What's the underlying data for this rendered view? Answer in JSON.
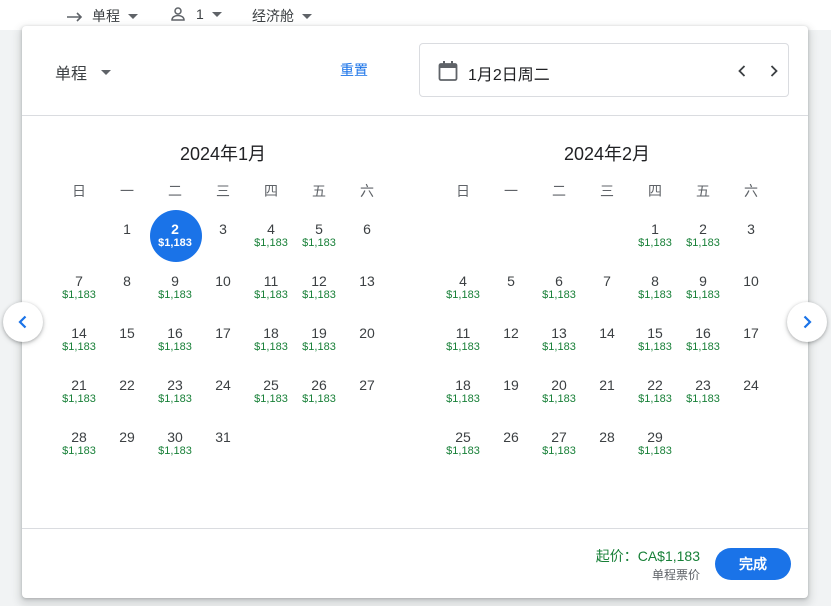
{
  "topbar": {
    "trip_type": "单程",
    "passengers": "1",
    "cabin": "经济舱"
  },
  "dialog": {
    "trip_select": "单程",
    "reset": "重置",
    "selected_date": "1月2日周二",
    "weekdays": [
      "日",
      "一",
      "二",
      "三",
      "四",
      "五",
      "六"
    ],
    "months": [
      {
        "title": "2024年1月",
        "first_weekday": 1,
        "days": [
          {
            "n": "1",
            "p": ""
          },
          {
            "n": "2",
            "p": "$1,183",
            "selected": true
          },
          {
            "n": "3",
            "p": ""
          },
          {
            "n": "4",
            "p": "$1,183"
          },
          {
            "n": "5",
            "p": "$1,183"
          },
          {
            "n": "6",
            "p": ""
          },
          {
            "n": "7",
            "p": "$1,183"
          },
          {
            "n": "8",
            "p": ""
          },
          {
            "n": "9",
            "p": "$1,183"
          },
          {
            "n": "10",
            "p": ""
          },
          {
            "n": "11",
            "p": "$1,183"
          },
          {
            "n": "12",
            "p": "$1,183"
          },
          {
            "n": "13",
            "p": ""
          },
          {
            "n": "14",
            "p": "$1,183"
          },
          {
            "n": "15",
            "p": ""
          },
          {
            "n": "16",
            "p": "$1,183"
          },
          {
            "n": "17",
            "p": ""
          },
          {
            "n": "18",
            "p": "$1,183"
          },
          {
            "n": "19",
            "p": "$1,183"
          },
          {
            "n": "20",
            "p": ""
          },
          {
            "n": "21",
            "p": "$1,183"
          },
          {
            "n": "22",
            "p": ""
          },
          {
            "n": "23",
            "p": "$1,183"
          },
          {
            "n": "24",
            "p": ""
          },
          {
            "n": "25",
            "p": "$1,183"
          },
          {
            "n": "26",
            "p": "$1,183"
          },
          {
            "n": "27",
            "p": ""
          },
          {
            "n": "28",
            "p": "$1,183"
          },
          {
            "n": "29",
            "p": ""
          },
          {
            "n": "30",
            "p": "$1,183"
          },
          {
            "n": "31",
            "p": ""
          }
        ]
      },
      {
        "title": "2024年2月",
        "first_weekday": 4,
        "days": [
          {
            "n": "1",
            "p": "$1,183"
          },
          {
            "n": "2",
            "p": "$1,183"
          },
          {
            "n": "3",
            "p": ""
          },
          {
            "n": "4",
            "p": "$1,183"
          },
          {
            "n": "5",
            "p": ""
          },
          {
            "n": "6",
            "p": "$1,183"
          },
          {
            "n": "7",
            "p": ""
          },
          {
            "n": "8",
            "p": "$1,183"
          },
          {
            "n": "9",
            "p": "$1,183"
          },
          {
            "n": "10",
            "p": ""
          },
          {
            "n": "11",
            "p": "$1,183"
          },
          {
            "n": "12",
            "p": ""
          },
          {
            "n": "13",
            "p": "$1,183"
          },
          {
            "n": "14",
            "p": ""
          },
          {
            "n": "15",
            "p": "$1,183"
          },
          {
            "n": "16",
            "p": "$1,183"
          },
          {
            "n": "17",
            "p": ""
          },
          {
            "n": "18",
            "p": "$1,183"
          },
          {
            "n": "19",
            "p": ""
          },
          {
            "n": "20",
            "p": "$1,183"
          },
          {
            "n": "21",
            "p": ""
          },
          {
            "n": "22",
            "p": "$1,183"
          },
          {
            "n": "23",
            "p": "$1,183"
          },
          {
            "n": "24",
            "p": ""
          },
          {
            "n": "25",
            "p": "$1,183"
          },
          {
            "n": "26",
            "p": ""
          },
          {
            "n": "27",
            "p": "$1,183"
          },
          {
            "n": "28",
            "p": ""
          },
          {
            "n": "29",
            "p": "$1,183"
          }
        ]
      }
    ],
    "from_price": "起价：CA$1,183",
    "price_note": "单程票价",
    "done": "完成"
  },
  "icons": {
    "arrow": "arrow-right-icon",
    "person": "person-icon",
    "calendar": "calendar-icon",
    "prev": "chevron-left-icon",
    "next": "chevron-right-icon"
  },
  "colors": {
    "accent": "#1a73e8",
    "price": "#188038"
  }
}
